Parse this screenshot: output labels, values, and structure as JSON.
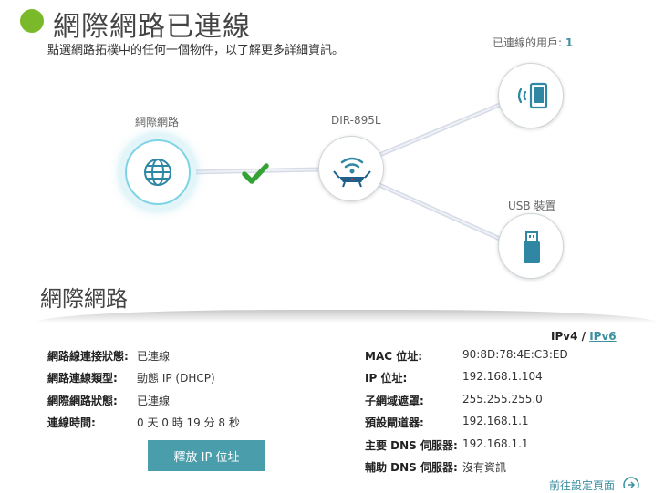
{
  "header": {
    "status_color": "#7ab929",
    "title": "網際網路已連線",
    "subtitle": "點選網路拓樸中的任何一個物件，以了解更多詳細資訊。"
  },
  "topology": {
    "users_label": "已連線的用戶:",
    "users_count": "1",
    "internet_label": "網際網路",
    "router_label": "DIR-895L",
    "usb_label": "USB 裝置",
    "connection_status_icon": "green-checkmark-icon",
    "accent_color": "#3d8fa0"
  },
  "details": {
    "section_title": "網際網路",
    "tab_ipv4": "IPv4",
    "tab_separator": "/",
    "tab_ipv6": "IPv6",
    "left": [
      {
        "label": "網路線連接狀態:",
        "value": "已連線"
      },
      {
        "label": "網路連線類型:",
        "value": "動態 IP (DHCP)"
      },
      {
        "label": "網際網路狀態:",
        "value": "已連線"
      },
      {
        "label": "連線時間:",
        "value": "0 天 0 時 19 分 8 秒"
      }
    ],
    "right": [
      {
        "label": "MAC 位址:",
        "value": "90:8D:78:4E:C3:ED"
      },
      {
        "label": "IP 位址:",
        "value": "192.168.1.104"
      },
      {
        "label": "子網域遮罩:",
        "value": "255.255.255.0"
      },
      {
        "label": "預設閘道器:",
        "value": "192.168.1.1"
      },
      {
        "label": "主要 DNS 伺服器:",
        "value": "192.168.1.1"
      },
      {
        "label": "輔助 DNS 伺服器:",
        "value": "沒有資訊"
      }
    ],
    "release_button": "釋放 IP 位址",
    "settings_link": "前往設定頁面"
  }
}
